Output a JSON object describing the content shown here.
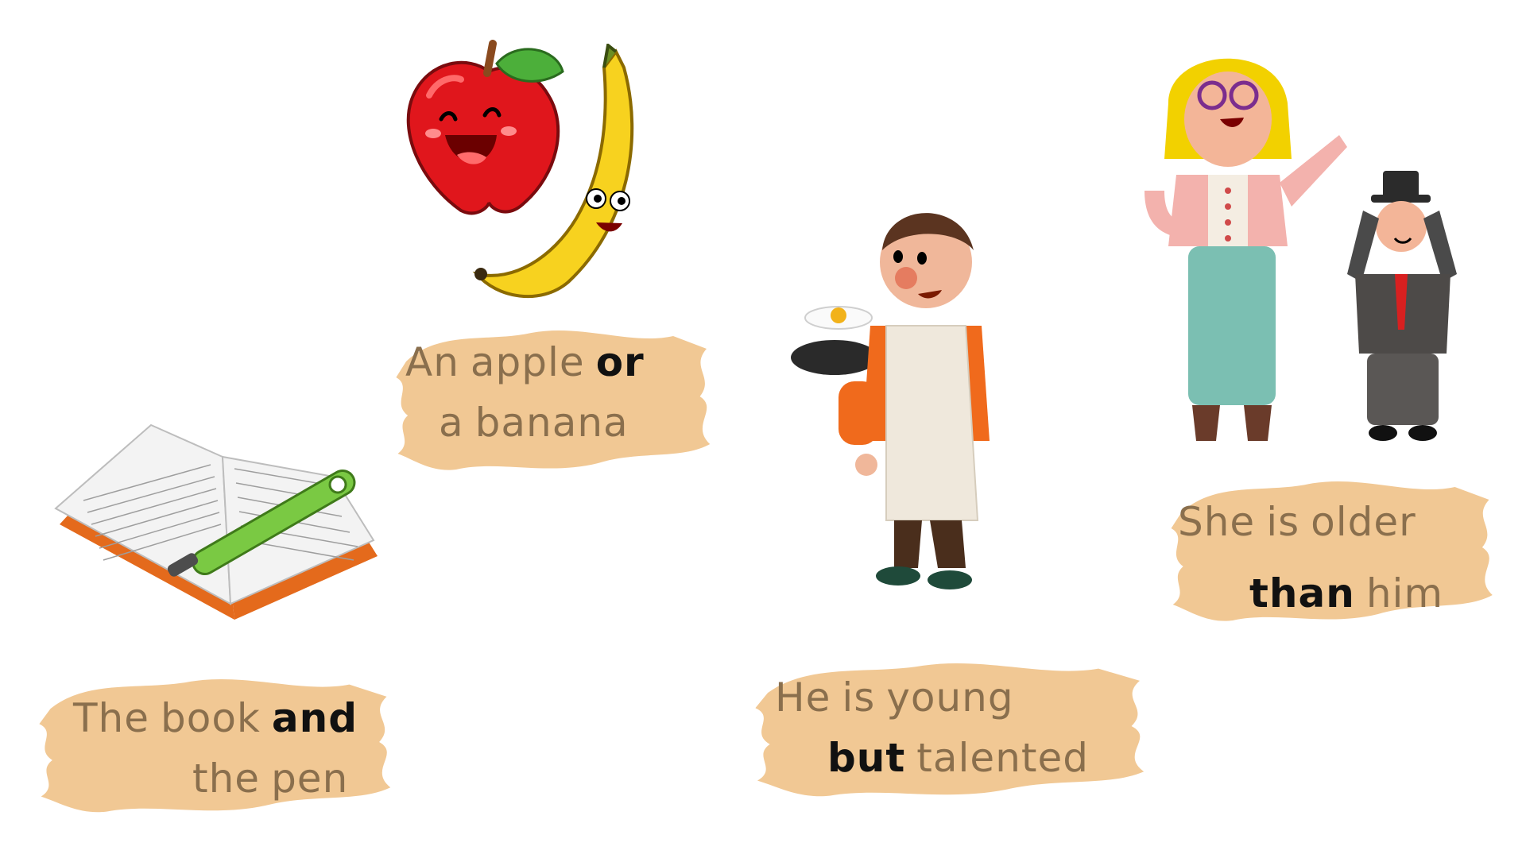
{
  "colors": {
    "background": "#ffffff",
    "brush": "#f1c894",
    "caption_text": "#8a6f4d",
    "conjunction_text": "#111111"
  },
  "cards": [
    {
      "line1": [
        "An",
        "apple"
      ],
      "key": "or",
      "line2": [
        "a",
        "banana"
      ]
    },
    {
      "line1": [
        "The",
        "book"
      ],
      "key": "and",
      "line2": [
        "the",
        "pen"
      ]
    },
    {
      "line1": [
        "He",
        "is",
        "young"
      ],
      "key": "but",
      "line2": [
        "talented"
      ]
    },
    {
      "line1": [
        "She",
        "is",
        "older"
      ],
      "key": "than",
      "line2": [
        "him"
      ]
    }
  ],
  "illustrations": [
    {
      "name": "apple",
      "icon": "smiling-apple"
    },
    {
      "name": "banana",
      "icon": "smiling-banana"
    },
    {
      "name": "book",
      "icon": "open-book"
    },
    {
      "name": "pen",
      "icon": "green-pen"
    },
    {
      "name": "young-cook",
      "icon": "boy-with-frying-pan"
    },
    {
      "name": "woman",
      "icon": "woman-with-glasses"
    },
    {
      "name": "small-man",
      "icon": "man-with-top-hat"
    }
  ]
}
